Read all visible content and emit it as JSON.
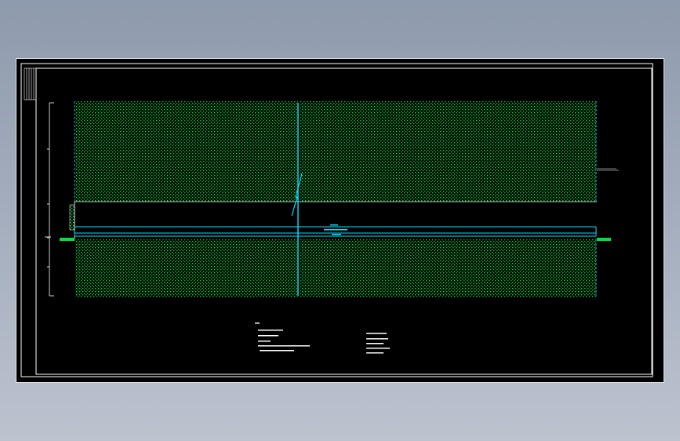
{
  "window": {
    "background_top": "#8e9aad",
    "background_bottom": "#bcc3cf",
    "drawing_background": "#000000"
  },
  "colors": {
    "frame": "#ffffff",
    "hatch": "#00e23b",
    "pipe": "#00e5ff",
    "section_line": "#00e5ff",
    "notes": "#ffffff"
  },
  "icons": {
    "hatch_pattern": "soil-hatch-icon",
    "break_line": "break-symbol-icon"
  },
  "annotations": {
    "left_elev": "",
    "right_elev": "",
    "pipe_label_top": "",
    "pipe_label_mid": "",
    "pipe_label_bottom": "",
    "side_label": "",
    "notes_title": "",
    "notes_left": [
      "",
      "",
      "",
      "",
      ""
    ],
    "notes_right": [
      "",
      "",
      "",
      "",
      ""
    ]
  }
}
